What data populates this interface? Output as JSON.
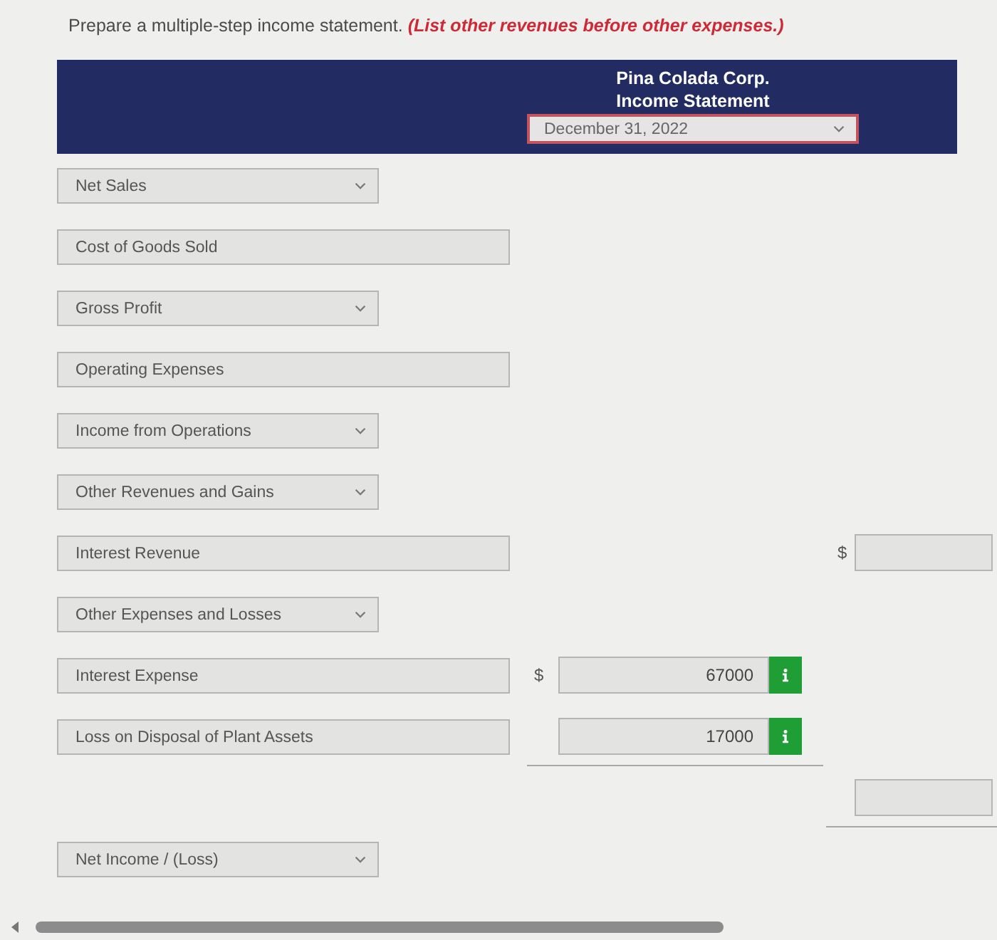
{
  "instruction": {
    "text": "Prepare a multiple-step income statement.",
    "note": "(List other revenues before other expenses.)"
  },
  "header": {
    "company": "Pina Colada Corp.",
    "title": "Income Statement",
    "date_field": {
      "value": "December 31, 2022",
      "invalid": true
    }
  },
  "rows": [
    {
      "kind": "dropdown",
      "label": "Net Sales"
    },
    {
      "kind": "field",
      "label": "Cost of Goods Sold"
    },
    {
      "kind": "dropdown",
      "label": "Gross Profit"
    },
    {
      "kind": "field",
      "label": "Operating Expenses"
    },
    {
      "kind": "dropdown",
      "label": "Income from Operations"
    },
    {
      "kind": "dropdown",
      "label": "Other Revenues and Gains"
    },
    {
      "kind": "field",
      "label": "Interest Revenue",
      "amount_2": {
        "currency": "$",
        "info": false,
        "underline": false
      }
    },
    {
      "kind": "dropdown",
      "label": "Other Expenses and Losses"
    },
    {
      "kind": "field",
      "label": "Interest Expense",
      "amount_1": {
        "currency": "$",
        "value": "67000",
        "info": true,
        "underline": false
      }
    },
    {
      "kind": "field",
      "label": "Loss on Disposal of Plant Assets",
      "amount_1": {
        "value": "17000",
        "info": true,
        "underline": true
      }
    },
    {
      "kind": "blank",
      "amount_2": {
        "info": false,
        "underline": true
      }
    },
    {
      "kind": "dropdown",
      "label": "Net Income / (Loss)"
    }
  ]
}
